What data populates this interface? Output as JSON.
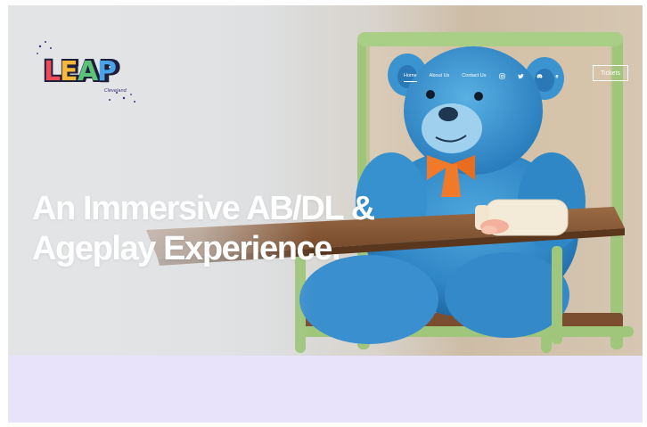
{
  "brand": {
    "logo_word": "LEAP",
    "logo_subtitle": "Cleveland"
  },
  "nav": {
    "items": [
      {
        "label": "Home",
        "active": true
      },
      {
        "label": "About Us",
        "active": false
      },
      {
        "label": "Contact Us",
        "active": false
      }
    ],
    "social_icons": [
      "instagram-icon",
      "twitter-icon",
      "discord-icon",
      "fetlife-icon"
    ],
    "tickets_label": "Tickets"
  },
  "hero": {
    "headline_line1": "An Immersive AB/DL &",
    "headline_line2": "Ageplay Experience."
  },
  "colors": {
    "band": "#e9e2fb",
    "bear_blue": "#3a8fce",
    "chair_green": "#9cc57a",
    "tray_brown": "#8a5a36",
    "text_white": "#ffffff"
  }
}
